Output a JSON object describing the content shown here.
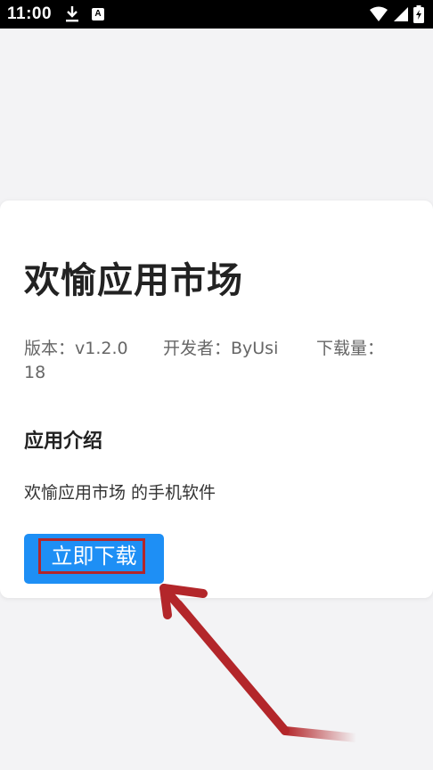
{
  "status_bar": {
    "time": "11:00",
    "icons": [
      "download-icon",
      "a-notification-icon",
      "wifi-icon",
      "signal-icon",
      "battery-charging-icon"
    ],
    "a_icon_letter": "A"
  },
  "app": {
    "title": "欢愉应用市场",
    "version": "版本：v1.2.0",
    "developer": "开发者：ByUsi",
    "downloads_label": "下载量：",
    "downloads_value": "18",
    "intro_title": "应用介绍",
    "intro_text": "欢愉应用市场 的手机软件",
    "download_button": "立即下载"
  },
  "colors": {
    "button": "#1e8ff5",
    "highlight": "#b3262a",
    "arrow": "#b3262a"
  }
}
